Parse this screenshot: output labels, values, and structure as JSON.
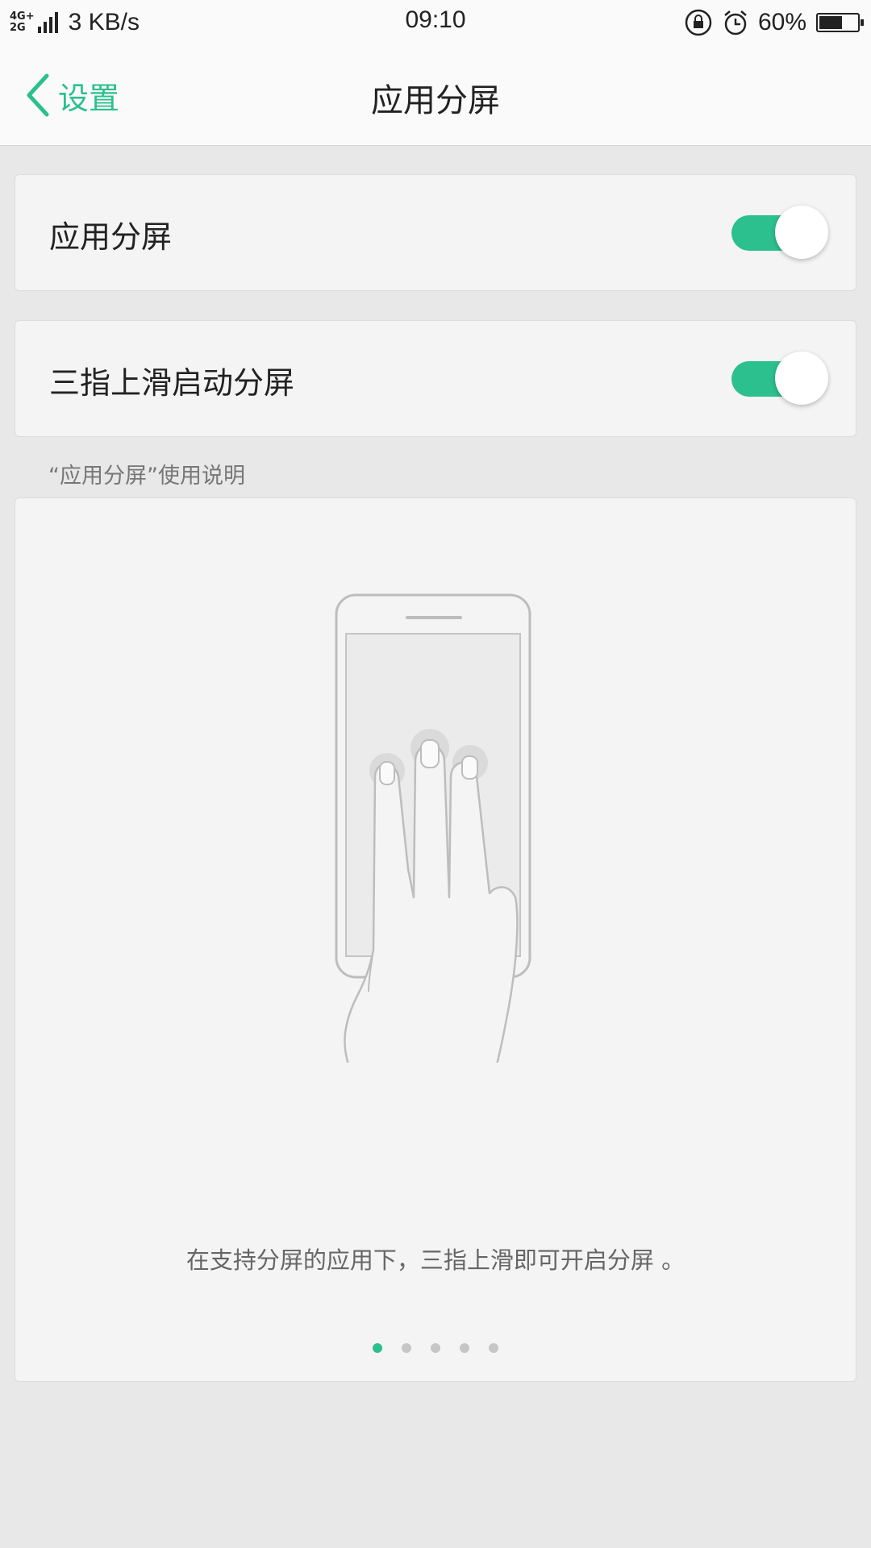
{
  "status_bar": {
    "network_top": "4G+",
    "network_bottom": "2G",
    "speed": "3 KB/s",
    "time": "09:10",
    "battery_percent": "60%",
    "battery_level": 0.6,
    "icons": [
      "rotation-lock-icon",
      "alarm-icon",
      "battery-icon"
    ]
  },
  "header": {
    "back_label": "设置",
    "title": "应用分屏"
  },
  "settings": [
    {
      "label": "应用分屏",
      "enabled": true
    },
    {
      "label": "三指上滑启动分屏",
      "enabled": true
    }
  ],
  "instructions": {
    "section_title": "“应用分屏”使用说明",
    "caption": "在支持分屏的应用下，三指上滑即可开启分屏 。",
    "page_count": 5,
    "current_page": 1
  },
  "colors": {
    "accent": "#2cc08e",
    "background": "#e8e8e8",
    "card": "#f4f4f4"
  }
}
